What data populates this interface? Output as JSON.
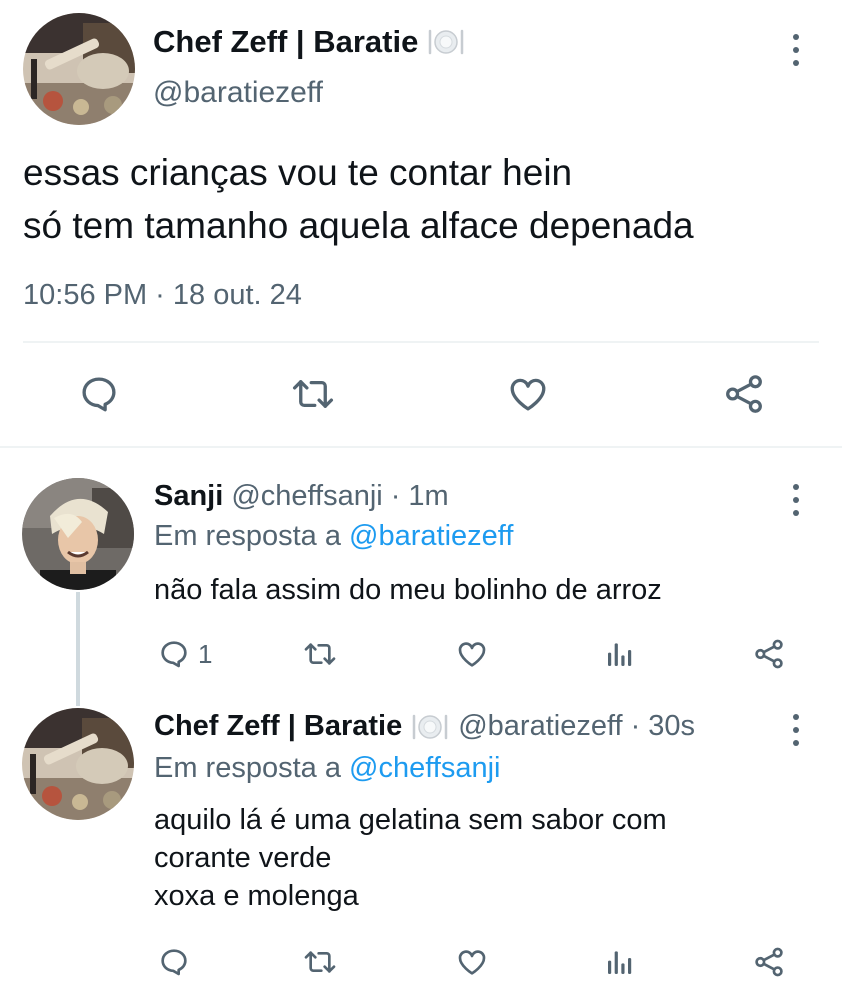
{
  "main_tweet": {
    "author_name": "Chef Zeff | Baratie",
    "author_handle": "@baratiezeff",
    "text_lines": [
      "essas crianças vou te contar hein",
      "só tem tamanho aquela alface depenada"
    ],
    "timestamp": "10:56 PM · 18 out. 24",
    "icons": [
      "reply-icon",
      "retweet-icon",
      "like-icon",
      "share-icon",
      "plate-emoji-icon",
      "more-options-icon"
    ]
  },
  "replies": [
    {
      "author_name": "Sanji",
      "author_handle": "@cheffsanji",
      "separator": "·",
      "time": "1m",
      "in_reply_prefix": "Em resposta a",
      "in_reply_to": "@baratiezeff",
      "text_lines": [
        "não fala assim do meu bolinho de arroz"
      ],
      "reply_count": "1"
    },
    {
      "author_name": "Chef Zeff | Baratie",
      "author_handle": "@baratiezeff",
      "separator": "·",
      "time": "30s",
      "in_reply_prefix": "Em resposta a",
      "in_reply_to": "@cheffsanji",
      "text_lines": [
        "aquilo lá é uma gelatina sem sabor com",
        "corante verde",
        "xoxa e molenga"
      ],
      "reply_count": ""
    }
  ],
  "colors": {
    "text": "#0f1419",
    "secondary": "#536471",
    "link": "#1d9bf0",
    "divider": "#eff3f4",
    "thread_line": "#cfd9de"
  }
}
